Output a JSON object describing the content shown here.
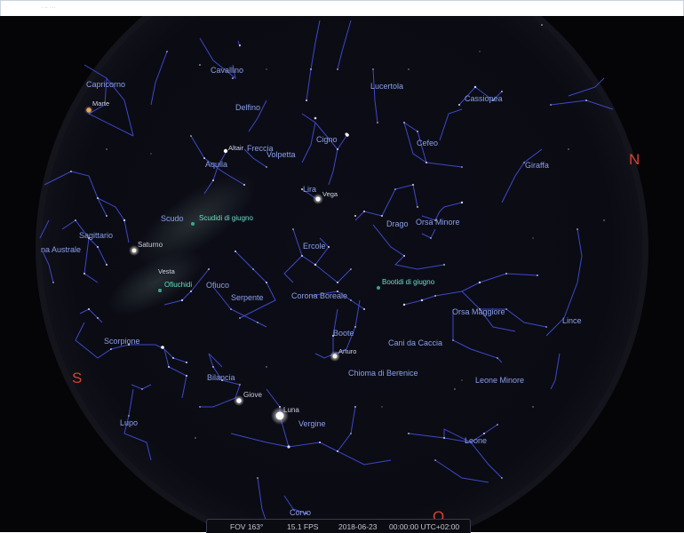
{
  "window": {
    "title": "· ·· · ··"
  },
  "colors": {
    "sky": "#050508",
    "lines": "#3d49c8",
    "constellation_label": "#8aa0ea",
    "meteor_label": "#66e0c8",
    "cardinal": "#d8422e"
  },
  "cardinals": {
    "north": "N",
    "south": "S",
    "west": "O"
  },
  "constellations": {
    "capricorno": "Capricorno",
    "cavallino": "Cavallino",
    "lucertola": "Lucertola",
    "cassiopea": "Cassiopea",
    "delfino": "Delfino",
    "freccia": "Freccia",
    "volpetta": "Volpetta",
    "cigno": "Cigno",
    "cefeo": "Cefeo",
    "giraffa": "Giraffa",
    "aquila": "Aquila",
    "lira": "Lira",
    "scudo": "Scudo",
    "drago": "Drago",
    "orsa_minore": "Orsa Minore",
    "sagittario": "Sagittario",
    "corona_australe": "na Australe",
    "ercole": "Ercole",
    "ofiuco": "Ofiuco",
    "serpente": "Serpente",
    "corona_boreale": "Corona Boreale",
    "orsa_maggiore": "Orsa Maggiore",
    "lince": "Lince",
    "scorpione": "Scorpione",
    "boote": "Boote",
    "cani_da_caccia": "Cani da Caccia",
    "chioma": "Chioma di Berenice",
    "leone_minore": "Leone Minore",
    "bilancia": "Bilancia",
    "lupo": "Lupo",
    "vergine": "Vergine",
    "leone": "Leone",
    "corvo": "Corvo"
  },
  "objects": {
    "marte": "Marte",
    "altair": "Altair",
    "vega": "Vega",
    "saturno": "Saturno",
    "vesta": "Vesta",
    "arturo": "Arturo",
    "giove": "Giove",
    "luna": "Luna"
  },
  "meteor_showers": {
    "scudidi": "Scudidi di giugno",
    "ofiuchidi": "Ofiuchidi",
    "bootidi": "Bootidi di giugno"
  },
  "status": {
    "fov": "FOV 163°",
    "fps": "15.1 FPS",
    "date": "2018-06-23",
    "time": "00:00:00 UTC+02:00"
  }
}
